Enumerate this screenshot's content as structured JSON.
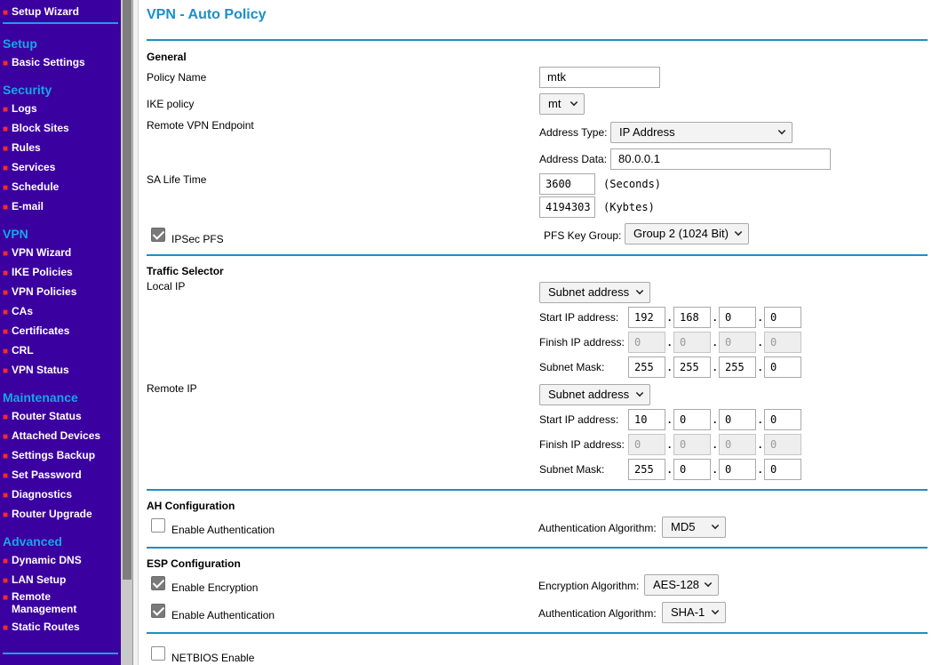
{
  "sidebar": {
    "top_item": "Setup Wizard",
    "groups": [
      {
        "heading": "Setup",
        "items": [
          "Basic Settings"
        ]
      },
      {
        "heading": "Security",
        "items": [
          "Logs",
          "Block Sites",
          "Rules",
          "Services",
          "Schedule",
          "E-mail"
        ]
      },
      {
        "heading": "VPN",
        "items": [
          "VPN Wizard",
          "IKE Policies",
          "VPN Policies",
          "CAs",
          "Certificates",
          "CRL",
          "VPN Status"
        ]
      },
      {
        "heading": "Maintenance",
        "items": [
          "Router Status",
          "Attached Devices",
          "Settings Backup",
          "Set Password",
          "Diagnostics",
          "Router Upgrade"
        ]
      },
      {
        "heading": "Advanced",
        "items": [
          "Dynamic DNS",
          "LAN Setup",
          "Remote Management",
          "Static Routes"
        ]
      }
    ]
  },
  "page": {
    "title": "VPN - Auto Policy"
  },
  "general": {
    "heading": "General",
    "policy_name_label": "Policy Name",
    "policy_name_value": "mtk",
    "ike_policy_label": "IKE policy",
    "ike_policy_value": "mt",
    "remote_endpoint_label": "Remote VPN Endpoint",
    "address_type_label": "Address Type:",
    "address_type_value": "IP Address",
    "address_data_label": "Address Data:",
    "address_data_value": "80.0.0.1",
    "sa_life_label": "SA Life Time",
    "sa_seconds_value": "3600",
    "sa_seconds_unit": "(Seconds)",
    "sa_kbytes_value": "4194303",
    "sa_kbytes_unit": "(Kybtes)",
    "ipsec_pfs_label": "IPSec PFS",
    "ipsec_pfs_checked": true,
    "pfs_group_label": "PFS Key Group:",
    "pfs_group_value": "Group 2 (1024 Bit)"
  },
  "traffic": {
    "heading": "Traffic Selector",
    "local": {
      "label": "Local IP",
      "type": "Subnet address",
      "start_label": "Start IP address:",
      "start": [
        "192",
        "168",
        "0",
        "0"
      ],
      "finish_label": "Finish IP address:",
      "finish": [
        "0",
        "0",
        "0",
        "0"
      ],
      "mask_label": "Subnet Mask:",
      "mask": [
        "255",
        "255",
        "255",
        "0"
      ]
    },
    "remote": {
      "label": "Remote IP",
      "type": "Subnet address",
      "start_label": "Start IP address:",
      "start": [
        "10",
        "0",
        "0",
        "0"
      ],
      "finish_label": "Finish IP address:",
      "finish": [
        "0",
        "0",
        "0",
        "0"
      ],
      "mask_label": "Subnet Mask:",
      "mask": [
        "255",
        "0",
        "0",
        "0"
      ]
    }
  },
  "ah": {
    "heading": "AH Configuration",
    "enable_auth_label": "Enable Authentication",
    "enable_auth_checked": false,
    "algo_label": "Authentication Algorithm:",
    "algo_value": "MD5"
  },
  "esp": {
    "heading": "ESP Configuration",
    "enable_enc_label": "Enable Encryption",
    "enable_enc_checked": true,
    "enc_algo_label": "Encryption Algorithm:",
    "enc_algo_value": "AES-128",
    "enable_auth_label": "Enable Authentication",
    "enable_auth_checked": true,
    "auth_algo_label": "Authentication Algorithm:",
    "auth_algo_value": "SHA-1"
  },
  "netbios": {
    "label": "NETBIOS Enable",
    "checked": false
  },
  "colors": {
    "sidebar_bg": "#3b00a0",
    "heading_blue": "#16a6e6",
    "bullet_red": "#ff2a2a",
    "title_blue": "#1b8fc7"
  }
}
